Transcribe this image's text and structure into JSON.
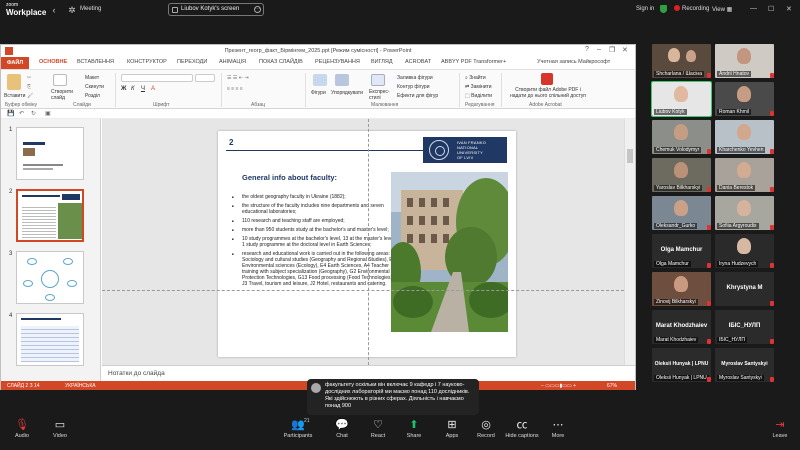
{
  "zoom": {
    "logo_top": "zoom",
    "logo_bottom": "Workplace",
    "meeting_label": "Meeting",
    "share_label": "Liubov Kotyk's screen",
    "signin_label": "Sign in",
    "recording_label": "Recording",
    "view_label": "View"
  },
  "ppt": {
    "title": "Презент_геогр_факт_Бірмінгем_2025.ppt [Режим сумісності] - PowerPoint",
    "tabs": [
      "ФАЙЛ",
      "ОСНОВНЕ",
      "ВСТАВЛЕННЯ",
      "КОНСТРУКТОР",
      "ПЕРЕХОДИ",
      "АНІМАЦІЯ",
      "ПОКАЗ СЛАЙДІВ",
      "РЕЦЕНЗУВАННЯ",
      "ВИГЛЯД",
      "ACROBAT",
      "ABBYY PDF Transformer+"
    ],
    "account": "Учетная запись Майкрософт",
    "ribbon": {
      "paste": "Вставити",
      "create_slide": "Створити слайд",
      "layout": "Макет",
      "reset": "Скинути",
      "section": "Розділ",
      "figures": "Фігури",
      "arrange": "Упорядкувати",
      "express_styles": "Експрес-стилі",
      "shape_fill": "Заливка фігури",
      "shape_outline": "Контур фігури",
      "shape_effects": "Ефекти для фігур",
      "find": "Знайти",
      "replace": "Замінити",
      "select": "Виділити",
      "create_pdf": "Створити файл Adobe PDF і надати до нього спільний доступ",
      "grp_clipboard": "Буфер обміну",
      "grp_slides": "Слайди",
      "grp_font": "Шрифт",
      "grp_paragraph": "Абзац",
      "grp_drawing": "Малювання",
      "grp_editing": "Редагування",
      "grp_acrobat": "Adobe Acrobat"
    },
    "slide_numbers": [
      "1",
      "2",
      "3",
      "4"
    ],
    "notes_placeholder": "Нотатки до слайда",
    "status_slide": "СЛАЙД 2 З 14",
    "status_lang": "УКРАЇНСЬКА",
    "zoom_level": "67%"
  },
  "slide": {
    "number": "2",
    "university": [
      "IVAN FRANKO",
      "NATIONAL",
      "UNIVERSITY",
      "OF LVIV"
    ],
    "title": "General info about faculty:",
    "bullets": [
      "the oldest geography faculty in Ukraine (1882);",
      "the structure of the faculty includes nine departments and seven educational laboratories;",
      "110 research and teaching staff are employed;",
      "more than 950 students study at the bachelor's and master's level;",
      "10 study programmes at the bachelor's level, 13 at the master's level, 1 study programme at the doctoral level in Earth Sciences;",
      "research and educational work is carried out in the following areas: C6 Sociology and cultural studies (Geography and Regional Studies), E2 Environmental sciences (Ecology), E4 Earth Sciences, A4 Teacher training with subject specialization (Geography), G2 Environmental Protection Technologies, G13 Food processing (Food Technologies), J3 Travel, tourism and leisure, J2 Hotel, restaurants and catering."
    ]
  },
  "participants": [
    {
      "name": "Shcharlana / Шасіна",
      "video": true
    },
    {
      "name": "Andrii Hnatov",
      "video": true
    },
    {
      "name": "Liubov Kotyk",
      "video": true,
      "active": true
    },
    {
      "name": "Roman Khmil",
      "video": true
    },
    {
      "name": "Chemuk Volodymyr",
      "video": true
    },
    {
      "name": "Kharchenko Yevhen",
      "video": true
    },
    {
      "name": "Yaroslav Bilkharskyi",
      "video": true
    },
    {
      "name": "Dania Berestok",
      "video": true
    },
    {
      "name": "Oleksandr_Gurko",
      "video": true
    },
    {
      "name": "Sofiia Argyroudis",
      "video": true
    },
    {
      "name": "Olga Mamchur",
      "video": false,
      "display": "Olga Mamchur"
    },
    {
      "name": "Iryna Hudzevych",
      "video": true
    },
    {
      "name": "Zinovij Bilkharskyi",
      "video": true
    },
    {
      "name": "Khrystyna M",
      "video": false,
      "display": "Khrystyna M"
    },
    {
      "name": "Marat Khodzhaiev",
      "video": false,
      "display": "Marat Khodzhaiev"
    },
    {
      "name": "ІБІС_НУЛП",
      "video": false,
      "display": "ІБІС_НУЛП"
    },
    {
      "name": "Oleksii Hunyak | LPNU",
      "video": false,
      "display": "Oleksii Hunyak | LPNU"
    },
    {
      "name": "Myroslav Santyskyi",
      "video": false,
      "display": "Myroslav Santyskyi"
    }
  ],
  "caption": "факультету оскільки він включає 9 кафедр і 7 науково-дослідних лабораторій ми маємо понад 110 дослідників. Які здійснюють в різних сферах. Діяльність і навчаємо понад 900",
  "toolbar": {
    "audio": "Audio",
    "video": "Video",
    "participants": "Participants",
    "participants_count": "21",
    "chat": "Chat",
    "react": "React",
    "share": "Share",
    "apps": "Apps",
    "record": "Record",
    "captions": "Hide captions",
    "more": "More",
    "leave": "Leave"
  },
  "colors": {
    "accent": "#d24726",
    "slide_navy": "#1f3864",
    "zoom_green": "#1fc26b",
    "zoom_red": "#e5383b"
  }
}
